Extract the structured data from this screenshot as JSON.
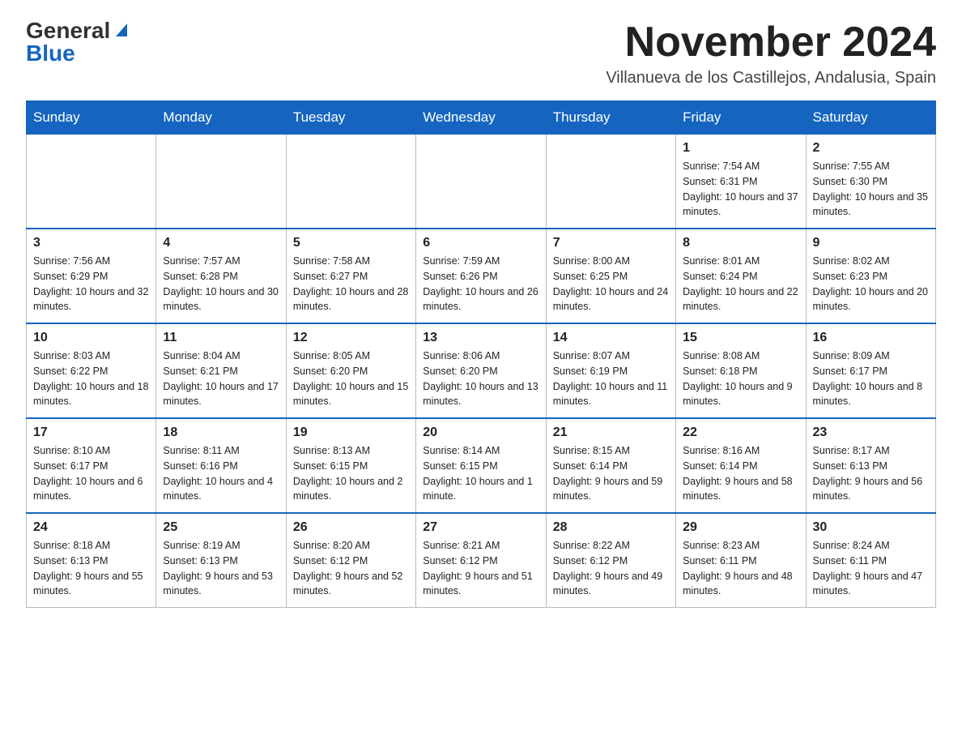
{
  "logo": {
    "general": "General",
    "blue": "Blue"
  },
  "header": {
    "title": "November 2024",
    "subtitle": "Villanueva de los Castillejos, Andalusia, Spain"
  },
  "weekdays": [
    "Sunday",
    "Monday",
    "Tuesday",
    "Wednesday",
    "Thursday",
    "Friday",
    "Saturday"
  ],
  "weeks": [
    [
      {
        "num": "",
        "info": ""
      },
      {
        "num": "",
        "info": ""
      },
      {
        "num": "",
        "info": ""
      },
      {
        "num": "",
        "info": ""
      },
      {
        "num": "",
        "info": ""
      },
      {
        "num": "1",
        "info": "Sunrise: 7:54 AM\nSunset: 6:31 PM\nDaylight: 10 hours and 37 minutes."
      },
      {
        "num": "2",
        "info": "Sunrise: 7:55 AM\nSunset: 6:30 PM\nDaylight: 10 hours and 35 minutes."
      }
    ],
    [
      {
        "num": "3",
        "info": "Sunrise: 7:56 AM\nSunset: 6:29 PM\nDaylight: 10 hours and 32 minutes."
      },
      {
        "num": "4",
        "info": "Sunrise: 7:57 AM\nSunset: 6:28 PM\nDaylight: 10 hours and 30 minutes."
      },
      {
        "num": "5",
        "info": "Sunrise: 7:58 AM\nSunset: 6:27 PM\nDaylight: 10 hours and 28 minutes."
      },
      {
        "num": "6",
        "info": "Sunrise: 7:59 AM\nSunset: 6:26 PM\nDaylight: 10 hours and 26 minutes."
      },
      {
        "num": "7",
        "info": "Sunrise: 8:00 AM\nSunset: 6:25 PM\nDaylight: 10 hours and 24 minutes."
      },
      {
        "num": "8",
        "info": "Sunrise: 8:01 AM\nSunset: 6:24 PM\nDaylight: 10 hours and 22 minutes."
      },
      {
        "num": "9",
        "info": "Sunrise: 8:02 AM\nSunset: 6:23 PM\nDaylight: 10 hours and 20 minutes."
      }
    ],
    [
      {
        "num": "10",
        "info": "Sunrise: 8:03 AM\nSunset: 6:22 PM\nDaylight: 10 hours and 18 minutes."
      },
      {
        "num": "11",
        "info": "Sunrise: 8:04 AM\nSunset: 6:21 PM\nDaylight: 10 hours and 17 minutes."
      },
      {
        "num": "12",
        "info": "Sunrise: 8:05 AM\nSunset: 6:20 PM\nDaylight: 10 hours and 15 minutes."
      },
      {
        "num": "13",
        "info": "Sunrise: 8:06 AM\nSunset: 6:20 PM\nDaylight: 10 hours and 13 minutes."
      },
      {
        "num": "14",
        "info": "Sunrise: 8:07 AM\nSunset: 6:19 PM\nDaylight: 10 hours and 11 minutes."
      },
      {
        "num": "15",
        "info": "Sunrise: 8:08 AM\nSunset: 6:18 PM\nDaylight: 10 hours and 9 minutes."
      },
      {
        "num": "16",
        "info": "Sunrise: 8:09 AM\nSunset: 6:17 PM\nDaylight: 10 hours and 8 minutes."
      }
    ],
    [
      {
        "num": "17",
        "info": "Sunrise: 8:10 AM\nSunset: 6:17 PM\nDaylight: 10 hours and 6 minutes."
      },
      {
        "num": "18",
        "info": "Sunrise: 8:11 AM\nSunset: 6:16 PM\nDaylight: 10 hours and 4 minutes."
      },
      {
        "num": "19",
        "info": "Sunrise: 8:13 AM\nSunset: 6:15 PM\nDaylight: 10 hours and 2 minutes."
      },
      {
        "num": "20",
        "info": "Sunrise: 8:14 AM\nSunset: 6:15 PM\nDaylight: 10 hours and 1 minute."
      },
      {
        "num": "21",
        "info": "Sunrise: 8:15 AM\nSunset: 6:14 PM\nDaylight: 9 hours and 59 minutes."
      },
      {
        "num": "22",
        "info": "Sunrise: 8:16 AM\nSunset: 6:14 PM\nDaylight: 9 hours and 58 minutes."
      },
      {
        "num": "23",
        "info": "Sunrise: 8:17 AM\nSunset: 6:13 PM\nDaylight: 9 hours and 56 minutes."
      }
    ],
    [
      {
        "num": "24",
        "info": "Sunrise: 8:18 AM\nSunset: 6:13 PM\nDaylight: 9 hours and 55 minutes."
      },
      {
        "num": "25",
        "info": "Sunrise: 8:19 AM\nSunset: 6:13 PM\nDaylight: 9 hours and 53 minutes."
      },
      {
        "num": "26",
        "info": "Sunrise: 8:20 AM\nSunset: 6:12 PM\nDaylight: 9 hours and 52 minutes."
      },
      {
        "num": "27",
        "info": "Sunrise: 8:21 AM\nSunset: 6:12 PM\nDaylight: 9 hours and 51 minutes."
      },
      {
        "num": "28",
        "info": "Sunrise: 8:22 AM\nSunset: 6:12 PM\nDaylight: 9 hours and 49 minutes."
      },
      {
        "num": "29",
        "info": "Sunrise: 8:23 AM\nSunset: 6:11 PM\nDaylight: 9 hours and 48 minutes."
      },
      {
        "num": "30",
        "info": "Sunrise: 8:24 AM\nSunset: 6:11 PM\nDaylight: 9 hours and 47 minutes."
      }
    ]
  ]
}
